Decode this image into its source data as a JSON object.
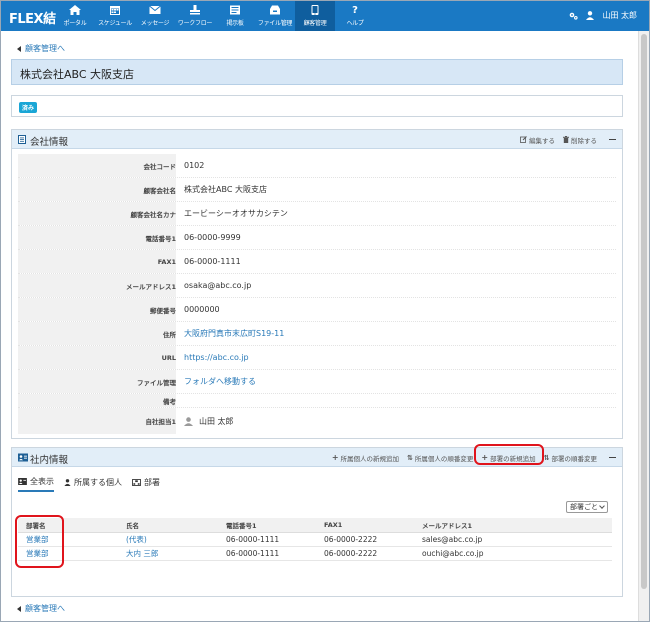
{
  "app": {
    "brand": "FLEX結",
    "user_name": "山田 太郎"
  },
  "nav": [
    {
      "label": "ポータル",
      "icon": "home-icon"
    },
    {
      "label": "スケジュール",
      "icon": "calendar-icon"
    },
    {
      "label": "メッセージ",
      "icon": "envelope-icon"
    },
    {
      "label": "ワークフロー",
      "icon": "workflow-icon"
    },
    {
      "label": "掲示板",
      "icon": "bulletin-icon"
    },
    {
      "label": "ファイル管理",
      "icon": "cabinet-icon"
    },
    {
      "label": "顧客管理",
      "icon": "phone-book-icon"
    },
    {
      "label": "ヘルプ",
      "icon": "help-icon"
    }
  ],
  "page": {
    "back_label": "顧客管理へ",
    "title": "株式会社ABC  大阪支店",
    "badge": "済み"
  },
  "company": {
    "panel_title": "会社情報",
    "edit_label": "編集する",
    "delete_label": "削除する",
    "rows": [
      {
        "label": "会社コード",
        "value": "0102"
      },
      {
        "label": "顧客会社名",
        "value": "株式会社ABC  大阪支店"
      },
      {
        "label": "顧客会社名カナ",
        "value": "エービーシーオオサカシテン"
      },
      {
        "label": "電話番号1",
        "value": "06-0000-9999"
      },
      {
        "label": "FAX1",
        "value": "06-0000-1111"
      },
      {
        "label": "メールアドレス1",
        "value": "osaka@abc.co.jp"
      },
      {
        "label": "郵便番号",
        "value": "0000000"
      },
      {
        "label": "住所",
        "value": "大阪府門真市末広町S19-11"
      },
      {
        "label": "URL",
        "value": "https://abc.co.jp"
      },
      {
        "label": "ファイル管理",
        "value": "フォルダへ移動する"
      },
      {
        "label": "備考",
        "value": ""
      },
      {
        "label": "自社担当1",
        "value": "山田 太郎"
      }
    ]
  },
  "internal": {
    "panel_title": "社内情報",
    "actions": [
      "所属個人の新規追加",
      "所属個人の順番変更",
      "部署の新規追加",
      "部署の順番変更"
    ],
    "tabs": [
      "全表示",
      "所属する個人",
      "部署"
    ],
    "select_value": "部署ごと",
    "columns": [
      "部署名",
      "氏名",
      "電話番号1",
      "FAX1",
      "メールアドレス1"
    ],
    "rows": [
      [
        "営業部",
        "(代表)",
        "06-0000-1111",
        "06-0000-2222",
        "sales@abc.co.jp"
      ],
      [
        "営業部",
        "大内  三郎",
        "06-0000-1111",
        "06-0000-2222",
        "ouchi@abc.co.jp"
      ]
    ]
  },
  "colors": {
    "nav": "#1a79c4",
    "highlight": "#e0141c",
    "link": "#2a7ab8"
  }
}
